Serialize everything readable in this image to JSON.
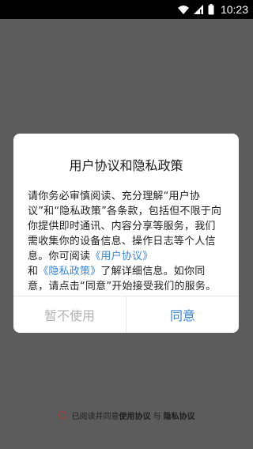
{
  "status": {
    "time": "10:23",
    "icons": [
      "wifi-icon",
      "signal-icon",
      "battery-icon"
    ]
  },
  "dialog": {
    "title": "用户协议和隐私政策",
    "body_part1": "请你务必审慎阅读、充分理解“用户协议”和“隐私政策”各条款，包括但不限于向你提供即时通讯、内容分享等服务，我们需收集你的设备信息、操作日志等个人信息。你可阅读",
    "link_user": "《用户协议》",
    "and": "和",
    "link_privacy": "《隐私政策》",
    "body_part2": "了解详细信息。如你同意，请点击“同意”开始接受我们的服务。",
    "cancel_label": "暂不使用",
    "agree_label": "同意"
  },
  "footer": {
    "prefix": "已阅读并同意",
    "user_agreement": "使用协议",
    "and": "与",
    "privacy_agreement": "隐私协议"
  },
  "colors": {
    "accent": "#3a86d0",
    "overlay": "#5c5c5c",
    "disabled": "#b3b3b3"
  }
}
